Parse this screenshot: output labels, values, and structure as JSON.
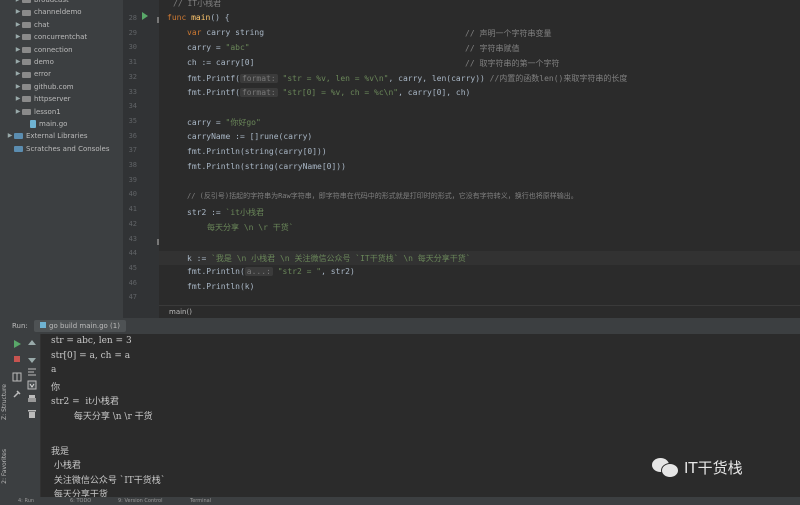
{
  "project_tree": {
    "items": [
      {
        "label": "broadcast",
        "type": "folder"
      },
      {
        "label": "channeldemo",
        "type": "folder"
      },
      {
        "label": "chat",
        "type": "folder"
      },
      {
        "label": "concurrentchat",
        "type": "folder"
      },
      {
        "label": "connection",
        "type": "folder"
      },
      {
        "label": "demo",
        "type": "folder"
      },
      {
        "label": "error",
        "type": "folder"
      },
      {
        "label": "github.com",
        "type": "folder"
      },
      {
        "label": "httpserver",
        "type": "folder"
      },
      {
        "label": "lesson1",
        "type": "folder"
      },
      {
        "label": "main.go",
        "type": "gofile"
      },
      {
        "label": "External Libraries",
        "type": "lib"
      },
      {
        "label": "Scratches and Consoles",
        "type": "scratch"
      }
    ]
  },
  "gutter": {
    "line_numbers": [
      "28",
      "29",
      "30",
      "31",
      "32",
      "33",
      "34",
      "35",
      "36",
      "37",
      "38",
      "39",
      "40",
      "41",
      "42",
      "43",
      "44",
      "45",
      "46",
      "47"
    ]
  },
  "editor": {
    "line0": "// IT小栈君",
    "l29_kw": "func ",
    "l29_fn": "main",
    "l29_rest": "() {",
    "l30_kw": "var ",
    "l30_code": "carry string",
    "l30_cm": "// 声明一个字符串变量",
    "l31_code": "carry = ",
    "l31_str": "\"abc\"",
    "l31_cm": "// 字符串赋值",
    "l32_code": "ch := carry[0]",
    "l32_cm": "// 取字符串的第一个字符",
    "l33_code": "fmt.Printf(",
    "l33_hint": "format:",
    "l33_str": "\"str = %v, len = %v\\n\"",
    "l33_rest": ", carry, len(carry)) ",
    "l33_cm": "//内置的函数len()来取字符串的长度",
    "l34_code": "fmt.Printf(",
    "l34_hint": "format:",
    "l34_str": "\"str[0] = %v, ch = %c\\n\"",
    "l34_rest": ", carry[0], ch)",
    "l36_code": "carry = ",
    "l36_str": "\"你好go\"",
    "l37_code": "carryName := []rune(carry)",
    "l38_code": "fmt.Println(string(carry[0]))",
    "l39_code": "fmt.Println(string(carryName[0]))",
    "l41_cm": "// (反引号)括起的字符串为Raw字符串，即字符串在代码中的形式就是打印时的形式，它没有字符转义，换行也将原样输出。",
    "l42_code": "str2 := ",
    "l42_str": "`it小栈君",
    "l43_str": "每天分享 \\n \\r 干货`",
    "l45_code": "k := ",
    "l45_str": "`我是 \\n 小栈君 \\n 关注微信公众号 `IT干货栈` \\n 每天分享干货`",
    "l46_code": "fmt.Println(",
    "l46_hint": "a...:",
    "l46_str": "\"str2 = \"",
    "l46_rest": ", str2)",
    "l47_code": "fmt.Println(k)"
  },
  "breadcrumb": {
    "label": "main()"
  },
  "run_panel": {
    "run_label": "Run:",
    "tab_label": "go build main.go (1)"
  },
  "console": {
    "lines": [
      "str = abc, len = 3",
      "str[0] = a, ch = a",
      "a",
      "你",
      "str2 =  it小栈君",
      "        每天分享 \\n \\r 干货",
      "",
      "我是",
      " 小栈君",
      " 关注微信公众号 `IT干货栈`",
      " 每天分享干货"
    ]
  },
  "side_labels": {
    "structure": "Z: Structure",
    "favorites": "2: Favorites"
  },
  "statusbar": {
    "run": "4: Run",
    "todo": "6: TODO",
    "version_control": "9: Version Control",
    "terminal": "Terminal"
  },
  "watermark": {
    "text": "IT干货栈"
  }
}
